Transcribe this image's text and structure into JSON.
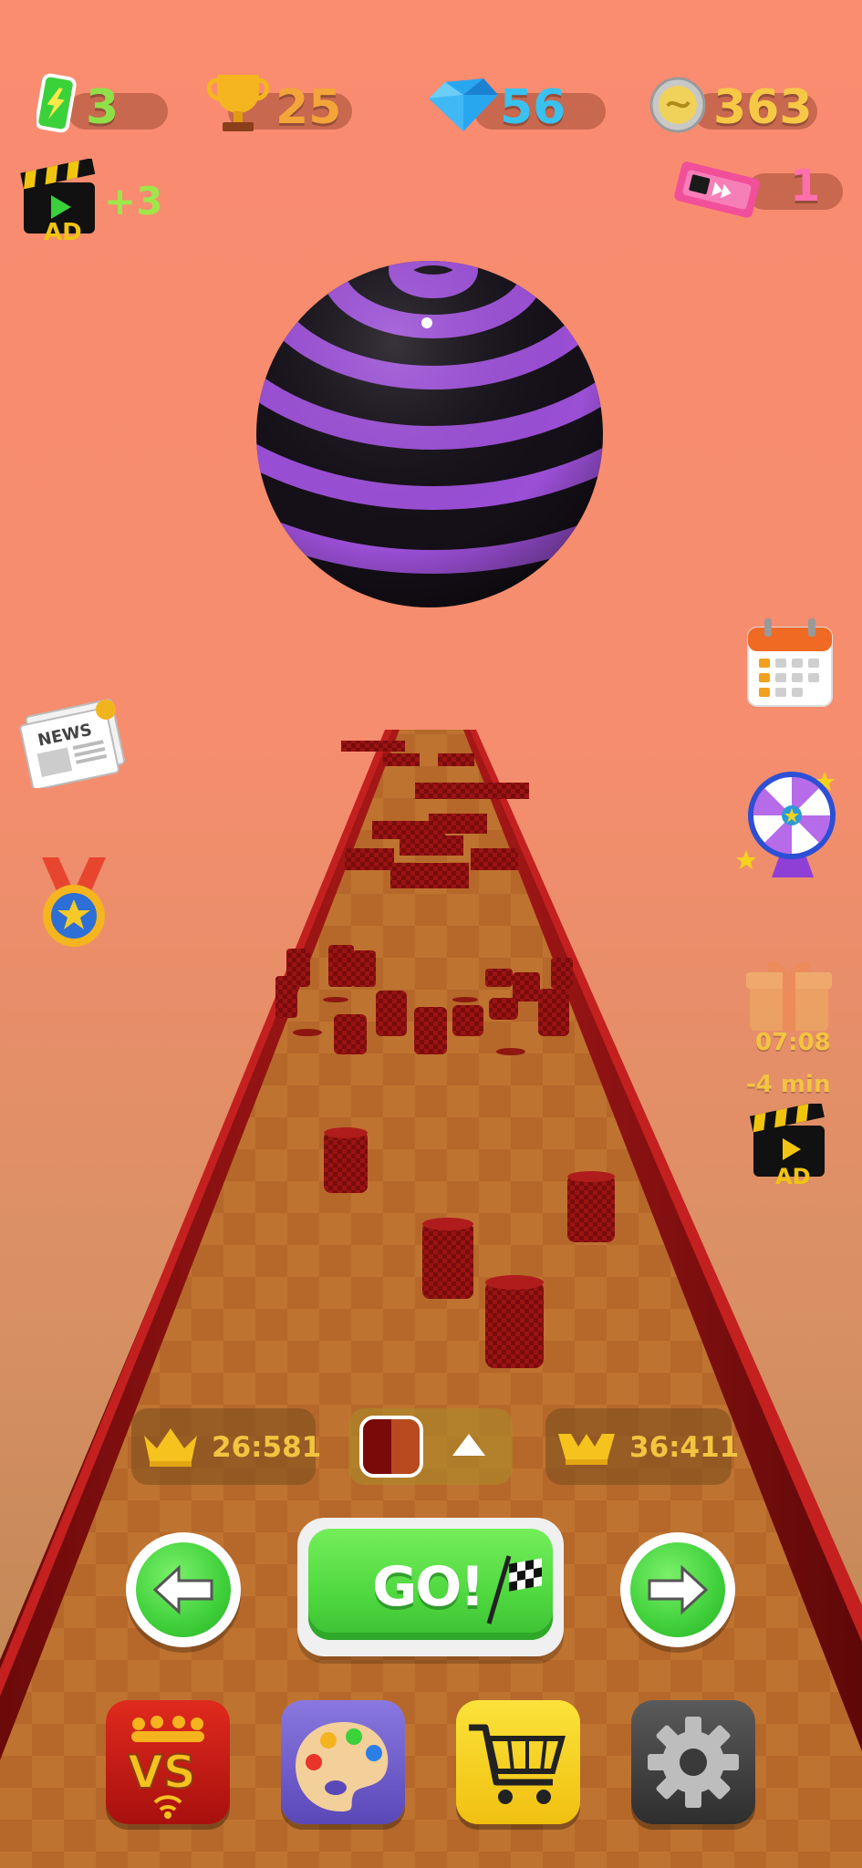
{
  "stats": {
    "energy": "3",
    "trophies": "25",
    "gems": "56",
    "coins": "363",
    "ad_bonus": "+3",
    "ad_label": "AD",
    "tickets": "1"
  },
  "side": {
    "news_label": "NEWS",
    "gift_timer": "07:08",
    "gift_reduce": "-4 min",
    "gift_ad_label": "AD"
  },
  "records": {
    "best": "26:581",
    "second": "36:411"
  },
  "controls": {
    "go_label": "GO!"
  },
  "colors": {
    "ball_purple": "#9b4fd6",
    "ball_black": "#151018",
    "track_red": "#8a1010",
    "floor_brown": "#b86a2a",
    "accent_green": "#4fd83f",
    "gold": "#f3c440"
  }
}
